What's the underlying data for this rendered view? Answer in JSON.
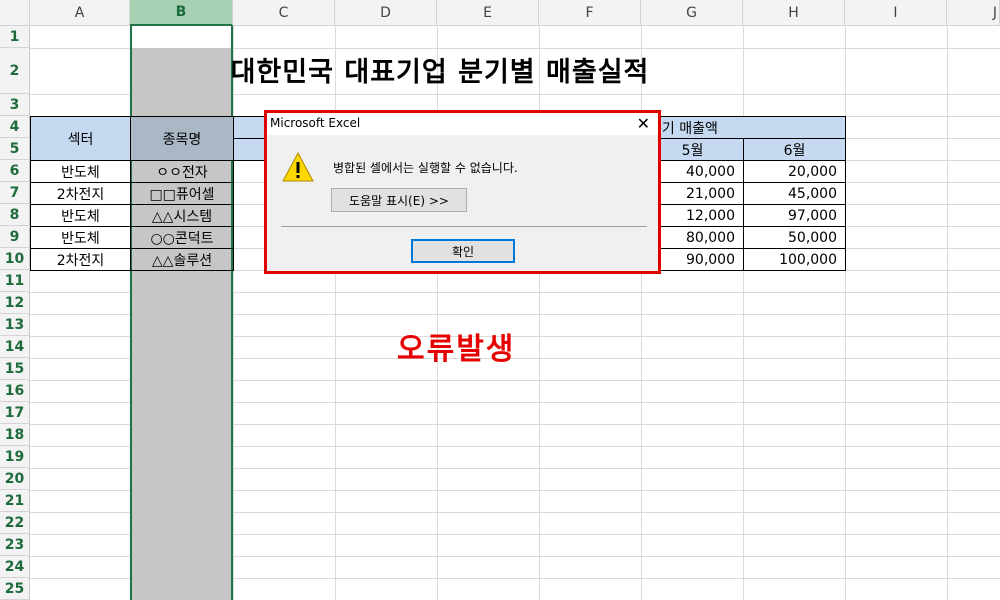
{
  "spreadsheet": {
    "columns": [
      "A",
      "B",
      "C",
      "D",
      "E",
      "F",
      "G",
      "H",
      "I",
      "J"
    ],
    "rows": [
      "1",
      "2",
      "3",
      "4",
      "5",
      "6",
      "7",
      "8",
      "9",
      "10",
      "11",
      "12",
      "13",
      "14",
      "15",
      "16",
      "17",
      "18",
      "19",
      "20",
      "21",
      "22",
      "23",
      "24",
      "25"
    ],
    "title": "대한민국 대표기업 분기별 매출실적",
    "header": {
      "sector": "섹터",
      "stock": "종목명",
      "quarter_sales": "분기 매출액",
      "month5": "5월",
      "month6": "6월"
    },
    "data_rows": [
      {
        "sector": "반도체",
        "stock": "ㅇㅇ전자",
        "g": "40,000",
        "h": "20,000"
      },
      {
        "sector": "2차전지",
        "stock": "□□퓨어셀",
        "g": "21,000",
        "h": "45,000"
      },
      {
        "sector": "반도체",
        "stock": "△△시스템",
        "g": "12,000",
        "h": "97,000"
      },
      {
        "sector": "반도체",
        "stock": "○○콘덕트",
        "g": "80,000",
        "h": "50,000"
      },
      {
        "sector": "2차전지",
        "stock": "△△솔루션",
        "g": "90,000",
        "h": "100,000"
      }
    ]
  },
  "annotation": {
    "error_label": "오류발생"
  },
  "dialog": {
    "title": "Microsoft Excel",
    "close": "✕",
    "message": "병합된 셀에서는 실행할 수 없습니다.",
    "help_button": "도움말 표시(E) >>",
    "ok_button": "확인"
  },
  "colors": {
    "header_fill": "#c5daf0",
    "selected_column": "#c6c6c6",
    "excel_green": "#217346",
    "error_red": "#e60000"
  }
}
